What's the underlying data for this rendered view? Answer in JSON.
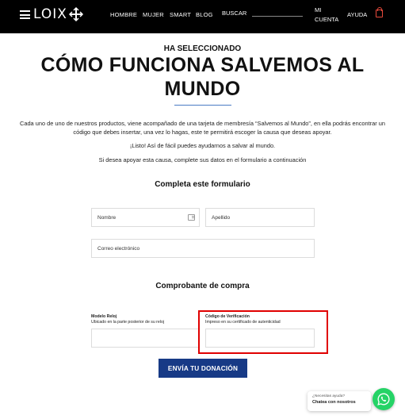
{
  "header": {
    "logo": "LOIX",
    "nav": [
      "HOMBRE",
      "MUJER",
      "SMART",
      "BLOG"
    ],
    "search_label": "BUSCAR",
    "account_line1": "MI",
    "account_line2": "CUENTA",
    "help": "AYUDA",
    "cart_icon": "shopping-bag-icon",
    "cart_color": "#e84a3c"
  },
  "page": {
    "subtitle": "HA SELECCIONADO",
    "title": "CÓMO FUNCIONA SALVEMOS AL MUNDO",
    "intro": "Cada uno de uno de nuestros productos, viene acompañado de una tarjeta de membresía “Salvemos al Mundo”, en ella podrás encontrar un código que debes insertar, una vez lo hagas, este te permitirá escoger la causa que deseas apoyar.",
    "line2": "¡Listo! Así de fácil puedes ayudarnos a salvar al mundo.",
    "line3": "Si desea apoyar esta causa, complete sus datos en el formulario a continuación",
    "accent_color": "#4a7bc4"
  },
  "form": {
    "section1_title": "Completa este formulario",
    "nombre_placeholder": "Nombre",
    "apellido_placeholder": "Apellido",
    "correo_placeholder": "Correo electrónico",
    "section2_title": "Comprobante de compra",
    "modelo_label": "Modelo Reloj",
    "modelo_hint": "Ubicado en la parte posterior de su reloj",
    "codigo_label": "Código de Verificación",
    "codigo_hint": "Impreso en su certificado de autenticidad",
    "submit": "ENVÍA TU DONACIÓN",
    "submit_color": "#173a86",
    "highlight_color": "#e00000"
  },
  "chat": {
    "question": "¿Necesitas ayuda?",
    "text": "Chatea con nosotros",
    "icon": "whatsapp-icon",
    "color": "#25d366"
  }
}
